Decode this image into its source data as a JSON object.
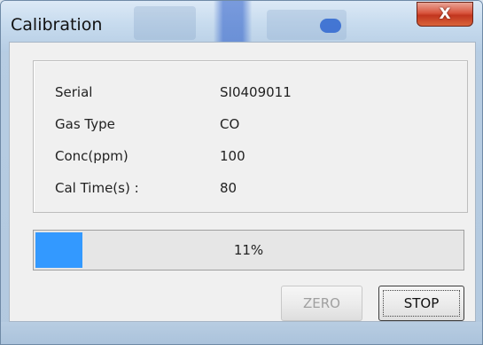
{
  "window": {
    "title": "Calibration",
    "close_label": "X"
  },
  "info": {
    "rows": [
      {
        "label": "Serial",
        "value": "SI0409011"
      },
      {
        "label": "Gas Type",
        "value": "CO"
      },
      {
        "label": "Conc(ppm)",
        "value": "100"
      },
      {
        "label": "Cal Time(s)  :",
        "value": "80"
      }
    ]
  },
  "progress": {
    "percent": 11,
    "text": "11%",
    "fill_color": "#3399ff"
  },
  "buttons": {
    "zero_label": "ZERO",
    "zero_enabled": false,
    "stop_label": "STOP"
  },
  "icons": {
    "close": "close-icon"
  }
}
